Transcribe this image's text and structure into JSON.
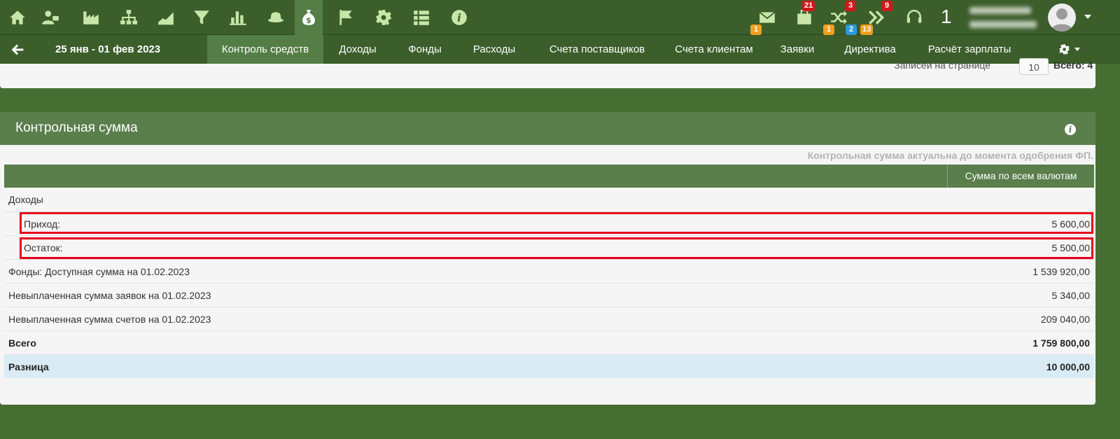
{
  "topbar": {
    "left_icons": [
      {
        "name": "home-icon",
        "active": false
      },
      {
        "name": "user-tie-icon",
        "active": false
      },
      {
        "name": "factory-icon",
        "active": false
      },
      {
        "name": "org-tree-icon",
        "active": false
      },
      {
        "name": "area-chart-icon",
        "active": false
      },
      {
        "name": "funnel-icon",
        "active": false
      },
      {
        "name": "bar-chart-icon",
        "active": false
      },
      {
        "name": "hat-icon",
        "active": false
      },
      {
        "name": "money-bag-icon",
        "active": true
      },
      {
        "name": "flag-icon",
        "active": false
      },
      {
        "name": "gear-icon",
        "active": false
      },
      {
        "name": "list-icon",
        "active": false
      },
      {
        "name": "info-circle-icon",
        "active": false
      }
    ],
    "notifications": {
      "mail_badge": "1",
      "tasks_badge": "21",
      "shuffle_badge_top": "3",
      "shuffle_badge_orange": "1",
      "shuffle_badge_blue": "2",
      "forward_badge_top": "9",
      "forward_badge_orange": "13"
    },
    "big_number": "1"
  },
  "navbar": {
    "date_range": "25 янв - 01 фев 2023",
    "tabs": [
      {
        "label": "Контроль средств",
        "active": true
      },
      {
        "label": "Доходы",
        "active": false
      },
      {
        "label": "Фонды",
        "active": false
      },
      {
        "label": "Расходы",
        "active": false
      },
      {
        "label": "Счета поставщиков",
        "active": false
      },
      {
        "label": "Счета клиентам",
        "active": false
      },
      {
        "label": "Заявки",
        "active": false
      },
      {
        "label": "Директива",
        "active": false
      },
      {
        "label": "Расчёт зарплаты",
        "active": false
      }
    ]
  },
  "prev_panel": {
    "per_page_label": "Записей на странице",
    "per_page_value": "10",
    "total_label": "Всего: 4"
  },
  "control_sum": {
    "title": "Контрольная сумма",
    "note": "Контрольная сумма актуальна до момента одобрения ФП.",
    "column_header": "Сумма по всем валютам",
    "rows": [
      {
        "label": "Доходы",
        "value": ""
      },
      {
        "label": "Приход:",
        "value": "5 600,00"
      },
      {
        "label": "Остаток:",
        "value": "5 500,00"
      },
      {
        "label": "Фонды: Доступная сумма на 01.02.2023",
        "value": "1 539 920,00"
      },
      {
        "label": "Невыплаченная сумма заявок на 01.02.2023",
        "value": "5 340,00"
      },
      {
        "label": "Невыплаченная сумма счетов на 01.02.2023",
        "value": "209 040,00"
      },
      {
        "label": "Всего",
        "value": "1 759 800,00"
      },
      {
        "label": "Разница",
        "value": "10 000,00"
      }
    ]
  },
  "colors": {
    "bar": "#3b5e2b",
    "active_tab": "#547e45",
    "panel_header": "#5a7e4c",
    "icon": "#c8e6a8",
    "highlight": "#e8001a",
    "diff_row": "#d9ebf5"
  }
}
